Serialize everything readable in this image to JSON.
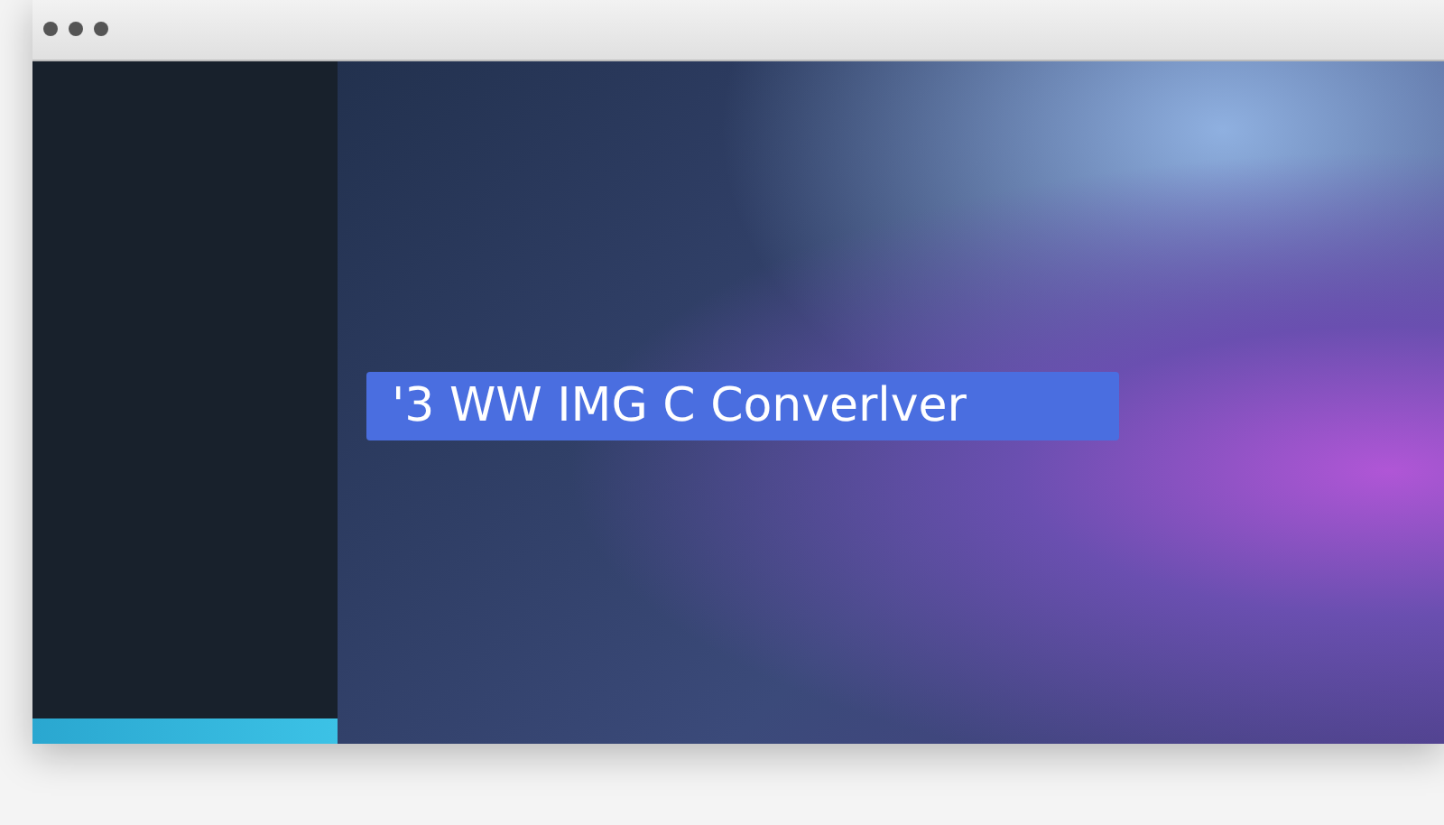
{
  "banner": {
    "text": "'3 WW  IMG C Converlver"
  }
}
